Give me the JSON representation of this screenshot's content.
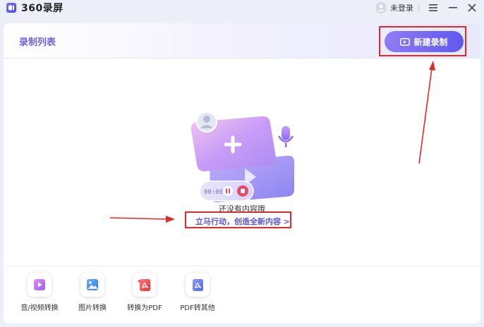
{
  "app": {
    "logo_text": "360录屏",
    "user_label": "未登录"
  },
  "header": {
    "title": "录制列表",
    "new_recording_label": "新建录制"
  },
  "empty_state": {
    "message": "还没有内容哦",
    "action_label": "立马行动，创造全新内容 >",
    "timer_text": "00:00"
  },
  "tools": [
    {
      "label": "音/视频转换",
      "icon": "audio-video-convert-icon"
    },
    {
      "label": "图片转换",
      "icon": "image-convert-icon"
    },
    {
      "label": "转换为PDF",
      "icon": "to-pdf-icon"
    },
    {
      "label": "PDF转其他",
      "icon": "pdf-to-other-icon"
    }
  ],
  "colors": {
    "accent": "#6c63e6",
    "button_gradient_start": "#8f7cf5",
    "button_gradient_end": "#5f58ec",
    "annotation": "#e02b2b"
  }
}
